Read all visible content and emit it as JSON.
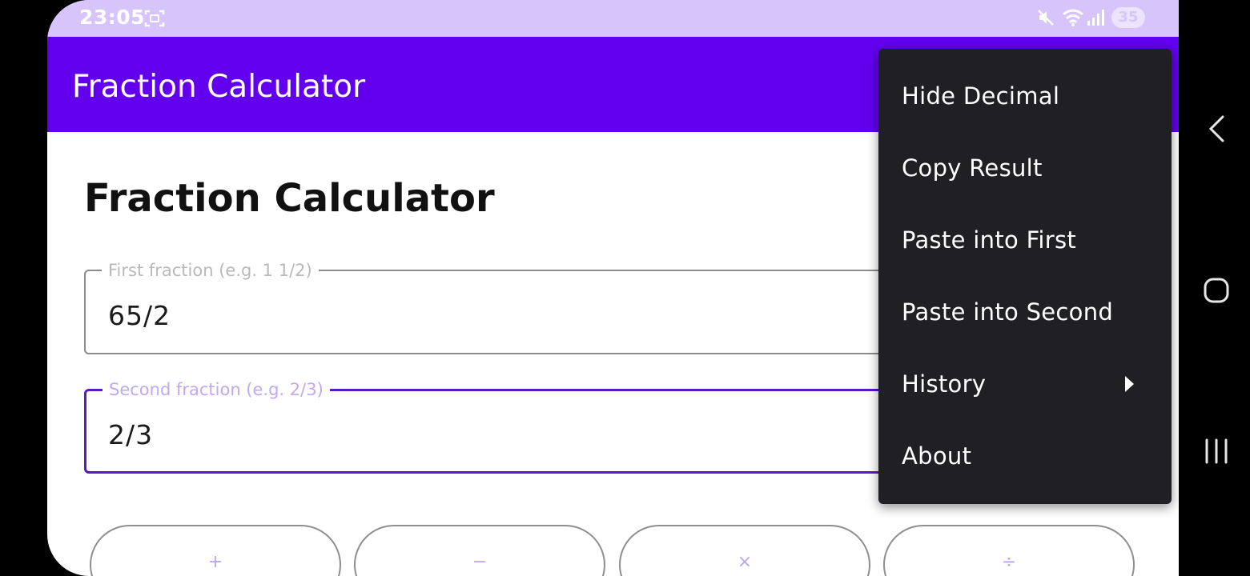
{
  "status_bar": {
    "time": "23:05",
    "battery": "35",
    "icons": [
      "screenshot-icon",
      "mute-icon",
      "wifi-icon",
      "signal-icon",
      "battery-icon"
    ]
  },
  "app_bar": {
    "title": "Fraction Calculator"
  },
  "main": {
    "title": "Fraction Calculator",
    "first_field": {
      "label": "First fraction (e.g. 1 1/2)",
      "value": "65/2"
    },
    "second_field": {
      "label": "Second fraction (e.g. 2/3)",
      "value": "2/3"
    },
    "operations": [
      "+",
      "−",
      "×",
      "÷"
    ]
  },
  "menu": {
    "items": [
      {
        "label": "Hide Decimal"
      },
      {
        "label": "Copy Result"
      },
      {
        "label": "Paste into First"
      },
      {
        "label": "Paste into Second"
      },
      {
        "label": "History",
        "has_submenu": true
      },
      {
        "label": "About"
      }
    ]
  },
  "nav_bar": {
    "icons": [
      "back-icon",
      "home-icon",
      "recents-icon"
    ]
  },
  "colors": {
    "status_bar": "#d6c4fb",
    "app_bar": "#6200ee",
    "focus_outline": "#5a18c9",
    "menu_background": "#202024"
  }
}
